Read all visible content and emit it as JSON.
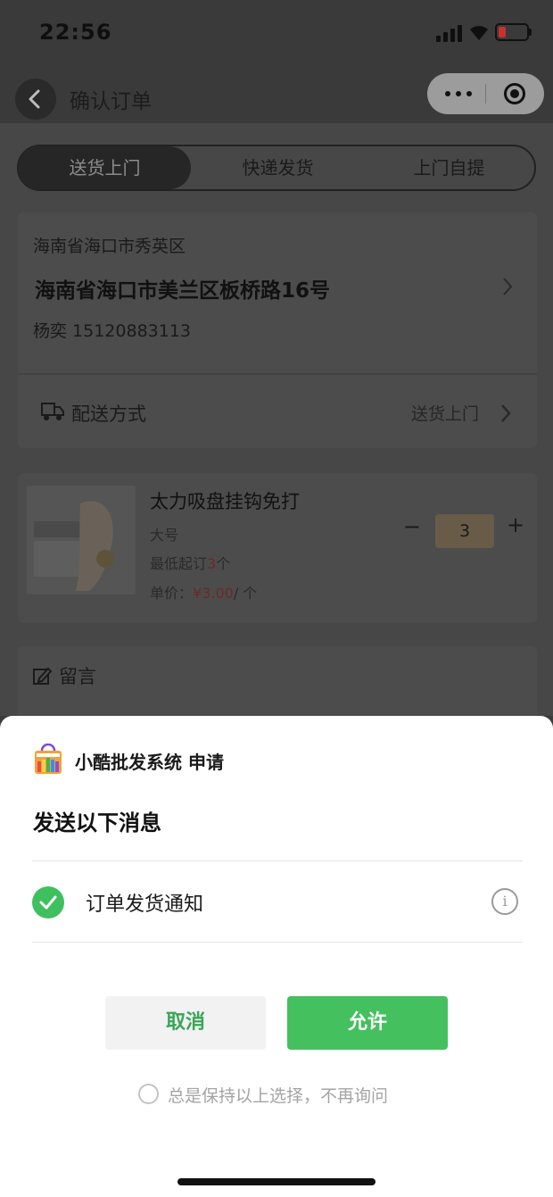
{
  "status_bar": {
    "time": "22:56"
  },
  "nav": {
    "title": "确认订单"
  },
  "tabs": [
    {
      "label": "送货上门",
      "active": true
    },
    {
      "label": "快递发货",
      "active": false
    },
    {
      "label": "上门自提",
      "active": false
    }
  ],
  "address": {
    "region": "海南省海口市秀英区",
    "detail": "海南省海口市美兰区板桥路16号",
    "contact": "杨奕 15120883113"
  },
  "delivery": {
    "label": "配送方式",
    "value": "送货上门"
  },
  "product": {
    "name": "太力吸盘挂钩免打",
    "spec": "大号",
    "min_prefix": "最低起订",
    "min_qty": "3",
    "min_unit": "个",
    "price_prefix": "单价：",
    "price": "¥3.00",
    "price_unit": "/ 个",
    "quantity": "3",
    "minus": "−",
    "plus": "+"
  },
  "note": {
    "label": "留言"
  },
  "sheet": {
    "app_name": "小酷批发系统 申请",
    "heading": "发送以下消息",
    "message": "订单发货通知",
    "info": "i",
    "cancel_label": "取消",
    "allow_label": "允许",
    "remember_label": "总是保持以上选择，不再询问"
  },
  "colors": {
    "accent_green": "#45c05e",
    "cancel_text": "#3aa557",
    "check_green": "#3fc05f"
  }
}
